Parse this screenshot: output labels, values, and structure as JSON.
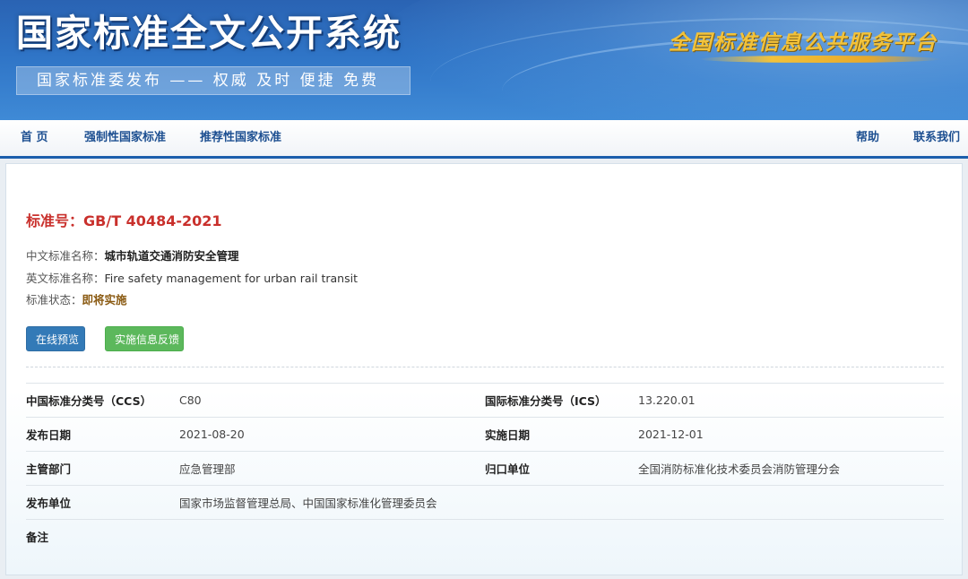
{
  "header": {
    "site_title": "国家标准全文公开系统",
    "slogan": "国家标准委发布 —— 权威 及时 便捷 免费",
    "platform_name": "全国标准信息公共服务平台"
  },
  "nav": {
    "home": "首 页",
    "mandatory": "强制性国家标准",
    "recommended": "推荐性国家标准",
    "help": "帮助",
    "contact": "联系我们"
  },
  "standard": {
    "number_label": "标准号：",
    "number": "GB/T 40484-2021",
    "cn_name_label": "中文标准名称：",
    "cn_name": "城市轨道交通消防安全管理",
    "en_name_label": "英文标准名称：",
    "en_name": "Fire safety management for urban rail transit",
    "status_label": "标准状态：",
    "status": "即将实施",
    "status_color": "#8a5a12"
  },
  "buttons": {
    "preview": "在线预览",
    "feedback": "实施信息反馈"
  },
  "meta": {
    "ccs_label": "中国标准分类号（CCS）",
    "ccs": "C80",
    "ics_label": "国际标准分类号（ICS）",
    "ics": "13.220.01",
    "publish_date_label": "发布日期",
    "publish_date": "2021-08-20",
    "effective_date_label": "实施日期",
    "effective_date": "2021-12-01",
    "dept_label": "主管部门",
    "dept": "应急管理部",
    "tc_label": "归口单位",
    "tc": "全国消防标准化技术委员会消防管理分会",
    "issuer_label": "发布单位",
    "issuer": "国家市场监督管理总局、中国国家标准化管理委员会",
    "remarks_label": "备注",
    "remarks": ""
  },
  "colors": {
    "brand_blue": "#1b5eac",
    "standard_number_red": "#c9302c",
    "preview_button": "#337ab7",
    "feedback_button": "#5cb85c",
    "platform_gold": "#f2c23a"
  }
}
